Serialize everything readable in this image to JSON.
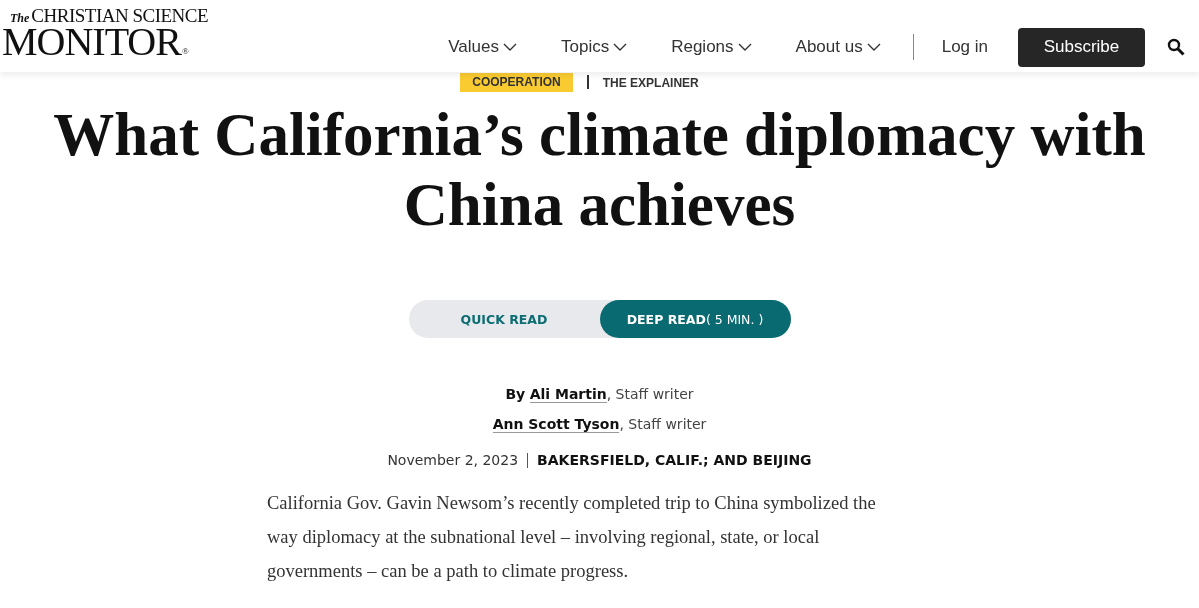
{
  "logo": {
    "prefix": "The",
    "top": "CHRISTIAN SCIENCE",
    "main": "MONITOR",
    "mark": "®"
  },
  "nav": {
    "items": [
      {
        "label": "Values",
        "expanded": false
      },
      {
        "label": "Topics",
        "expanded": false
      },
      {
        "label": "Regions",
        "expanded": false
      },
      {
        "label": "About us",
        "expanded": false
      }
    ],
    "login": "Log in",
    "subscribe": "Subscribe"
  },
  "tags": [
    "COOPERATION",
    "THE EXPLAINER"
  ],
  "headline": "What California’s climate diplomacy with China achieves",
  "read_toggle": [
    {
      "label": "QUICK READ",
      "selected": false
    },
    {
      "label": "DEEP READ",
      "suffix": "( 5 MIN. )",
      "selected": true
    }
  ],
  "bylines": [
    {
      "prefix": "By",
      "author": "Ali Martin",
      "role": ", Staff writer"
    },
    {
      "author": "Ann Scott Tyson",
      "role": ", Staff writer"
    }
  ],
  "date": "November 2, 2023",
  "dateline": "BAKERSFIELD, CALIF.; AND BEIJING",
  "summary": "California Gov. Gavin Newsom’s recently completed trip to China symbolized the way diplomacy at the subnational level – involving regional, state, or local governments – can be a path to climate progress."
}
